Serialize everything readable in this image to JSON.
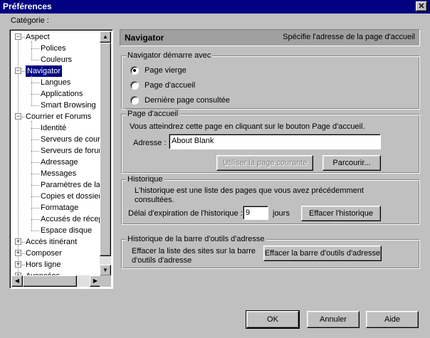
{
  "window": {
    "title": "Préférences",
    "close_glyph": "✕"
  },
  "category_label": "Catégorie :",
  "tree": {
    "items": [
      {
        "label": "Aspect",
        "level": 0,
        "expander": "−"
      },
      {
        "label": "Polices",
        "level": 1
      },
      {
        "label": "Couleurs",
        "level": 1
      },
      {
        "label": "Navigator",
        "level": 0,
        "expander": "−",
        "selected": true
      },
      {
        "label": "Langues",
        "level": 1
      },
      {
        "label": "Applications",
        "level": 1
      },
      {
        "label": "Smart Browsing",
        "level": 1
      },
      {
        "label": "Courrier et Forums",
        "level": 0,
        "expander": "−"
      },
      {
        "label": "Identité",
        "level": 1
      },
      {
        "label": "Serveurs de courri",
        "level": 1
      },
      {
        "label": "Serveurs de forum",
        "level": 1
      },
      {
        "label": "Adressage",
        "level": 1
      },
      {
        "label": "Messages",
        "level": 1
      },
      {
        "label": "Paramètres de la f",
        "level": 1
      },
      {
        "label": "Copies et dossiers",
        "level": 1
      },
      {
        "label": "Formatage",
        "level": 1
      },
      {
        "label": "Accusés de récep",
        "level": 1
      },
      {
        "label": "Espace disque",
        "level": 1
      },
      {
        "label": "Accès itinérant",
        "level": 0,
        "expander": "+"
      },
      {
        "label": "Composer",
        "level": 0,
        "expander": "+"
      },
      {
        "label": "Hors ligne",
        "level": 0,
        "expander": "+"
      },
      {
        "label": "Avancées",
        "level": 0,
        "expander": "+"
      }
    ]
  },
  "header": {
    "name": "Navigator",
    "description": "Spécifie l'adresse de la page d'accueil"
  },
  "startup": {
    "title": "Navigator démarre avec",
    "options": [
      "Page vierge",
      "Page d'accueil",
      "Dernière page consultée"
    ],
    "selected": "Page vierge"
  },
  "homepage": {
    "title": "Page d'accueil",
    "description": "Vous atteindrez cette page en cliquant sur le bouton Page d'accueil.",
    "address_label": "Adresse :",
    "address_value": "About Blank",
    "use_current_label": "Utiliser la page courante",
    "browse_label": "Parcourir..."
  },
  "history": {
    "title": "Historique",
    "description_line1": "L'historique est une liste des pages que vous avez précédemment",
    "description_line2": "consultées.",
    "expiry_label": "Délai d'expiration de l'historique :",
    "expiry_value": "9",
    "expiry_unit": "jours",
    "clear_label": "Effacer l'historique"
  },
  "location_bar": {
    "title": "Historique de la barre d'outils d'adresse",
    "description_line1": "Effacer la liste des sites sur la barre",
    "description_line2": "d'outils d'adresse",
    "clear_label": "Effacer la barre d'outils d'adresse"
  },
  "footer": {
    "ok_label": "OK",
    "cancel_label": "Annuler",
    "help_label": "Aide"
  },
  "scroll": {
    "up_glyph": "▲",
    "down_glyph": "▼",
    "left_glyph": "◀",
    "right_glyph": "▶"
  }
}
